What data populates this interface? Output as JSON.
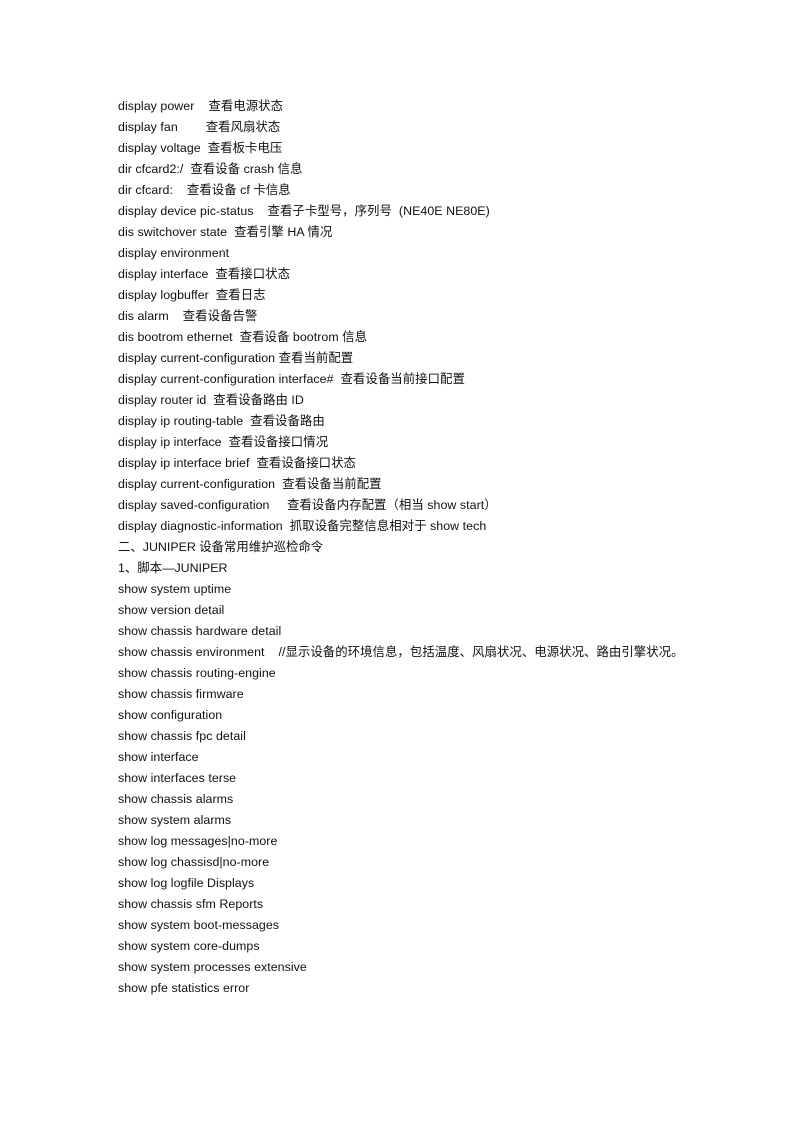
{
  "document": {
    "page_background": "#ffffff",
    "text_color": "#101010",
    "blocks": [
      {
        "type": "command",
        "text": "display power    查看电源状态"
      },
      {
        "type": "command",
        "text": "display fan        查看风扇状态"
      },
      {
        "type": "command",
        "text": "display voltage  查看板卡电压"
      },
      {
        "type": "command",
        "text": "dir cfcard2:/  查看设备 crash 信息"
      },
      {
        "type": "command",
        "text": "dir cfcard:    查看设备 cf 卡信息"
      },
      {
        "type": "command",
        "text": "display device pic-status    查看子卡型号，序列号  (NE40E NE80E)"
      },
      {
        "type": "command",
        "text": "dis switchover state  查看引擎 HA 情况"
      },
      {
        "type": "command",
        "text": "display environment"
      },
      {
        "type": "command",
        "text": "display interface  查看接口状态"
      },
      {
        "type": "command",
        "text": "display logbuffer  查看日志"
      },
      {
        "type": "command",
        "text": "dis alarm    查看设备告警"
      },
      {
        "type": "command",
        "text": "dis bootrom ethernet  查看设备 bootrom 信息"
      },
      {
        "type": "command",
        "text": "display current-configuration 查看当前配置"
      },
      {
        "type": "command",
        "text": "display current-configuration interface#  查看设备当前接口配置"
      },
      {
        "type": "command",
        "text": "display router id  查看设备路由 ID"
      },
      {
        "type": "command",
        "text": "display ip routing-table  查看设备路由"
      },
      {
        "type": "command",
        "text": "display ip interface  查看设备接口情况"
      },
      {
        "type": "command",
        "text": "display ip interface brief  查看设备接口状态"
      },
      {
        "type": "command",
        "text": "display current-configuration  查看设备当前配置"
      },
      {
        "type": "command",
        "text": "display saved-configuration     查看设备内存配置（相当 show start）"
      },
      {
        "type": "command",
        "text": "display diagnostic-information  抓取设备完整信息相对于 show tech"
      },
      {
        "type": "heading",
        "text": "二、JUNIPER 设备常用维护巡检命令"
      },
      {
        "type": "heading",
        "text": "1、脚本—JUNIPER"
      },
      {
        "type": "command",
        "text": "show system uptime"
      },
      {
        "type": "command",
        "text": "show version detail"
      },
      {
        "type": "command",
        "text": "show chassis hardware detail"
      },
      {
        "type": "command",
        "text": "show chassis environment    //显示设备的环境信息，包括温度、风扇状况、电源状况、路由引擎状况。",
        "wrapped": true
      },
      {
        "type": "command",
        "text": "show chassis routing-engine"
      },
      {
        "type": "command",
        "text": "show chassis firmware"
      },
      {
        "type": "command",
        "text": "show configuration"
      },
      {
        "type": "command",
        "text": "show chassis fpc detail"
      },
      {
        "type": "command",
        "text": "show interface"
      },
      {
        "type": "command",
        "text": "show interfaces terse"
      },
      {
        "type": "command",
        "text": "show chassis alarms"
      },
      {
        "type": "command",
        "text": "show system alarms"
      },
      {
        "type": "command",
        "text": "show log messages|no-more"
      },
      {
        "type": "command",
        "text": "show log chassisd|no-more"
      },
      {
        "type": "command",
        "text": "show log logfile Displays"
      },
      {
        "type": "command",
        "text": "show chassis sfm Reports"
      },
      {
        "type": "command",
        "text": "show system boot-messages"
      },
      {
        "type": "command",
        "text": "show system core-dumps"
      },
      {
        "type": "command",
        "text": "show system processes extensive"
      },
      {
        "type": "command",
        "text": "show pfe statistics error"
      }
    ]
  }
}
